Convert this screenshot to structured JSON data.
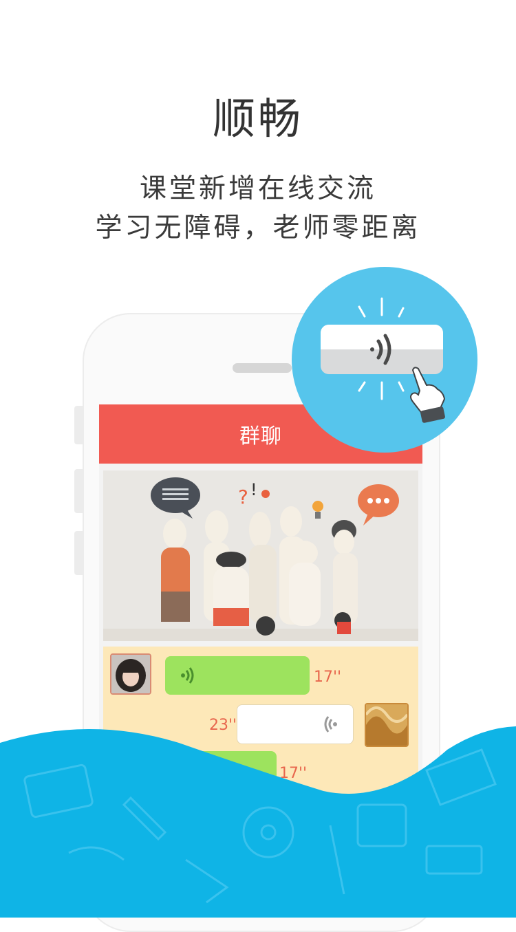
{
  "intro": {
    "headline": "顺畅",
    "subtitle_line1": "课堂新增在线交流",
    "subtitle_line2": "学习无障碍，老师零距离"
  },
  "app": {
    "header_title": "群聊"
  },
  "chat": {
    "messages": [
      {
        "side": "left",
        "duration": "17''"
      },
      {
        "side": "right",
        "duration": "23''"
      },
      {
        "side": "left",
        "duration": "17''"
      }
    ]
  },
  "colors": {
    "header": "#f15a52",
    "chat_background": "#fde8b8",
    "green_bubble": "#9de35e",
    "accent_circle": "#56c5ec",
    "wave": "#0fb4e6"
  },
  "icons": [
    "voice-icon",
    "tap-hand-icon",
    "speech-bubble-icon",
    "lightbulb-icon"
  ]
}
